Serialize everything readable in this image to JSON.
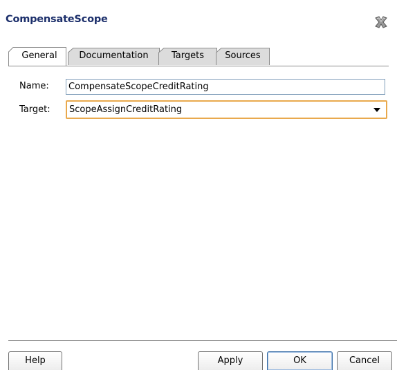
{
  "dialog": {
    "title": "CompensateScope",
    "close_icon": "close-x-icon"
  },
  "tabs": [
    {
      "label": "General",
      "active": true
    },
    {
      "label": "Documentation",
      "active": false
    },
    {
      "label": "Targets",
      "active": false
    },
    {
      "label": "Sources",
      "active": false
    }
  ],
  "form": {
    "name_label": "Name:",
    "name_value": "CompensateScopeCreditRating",
    "target_label": "Target:",
    "target_value": "ScopeAssignCreditRating"
  },
  "buttons": {
    "help": "Help",
    "apply": "Apply",
    "ok": "OK",
    "cancel": "Cancel"
  },
  "colors": {
    "title": "#1c2f6b",
    "focus_border": "#e9a94d",
    "inactive_tab": "#dcdcdc"
  }
}
